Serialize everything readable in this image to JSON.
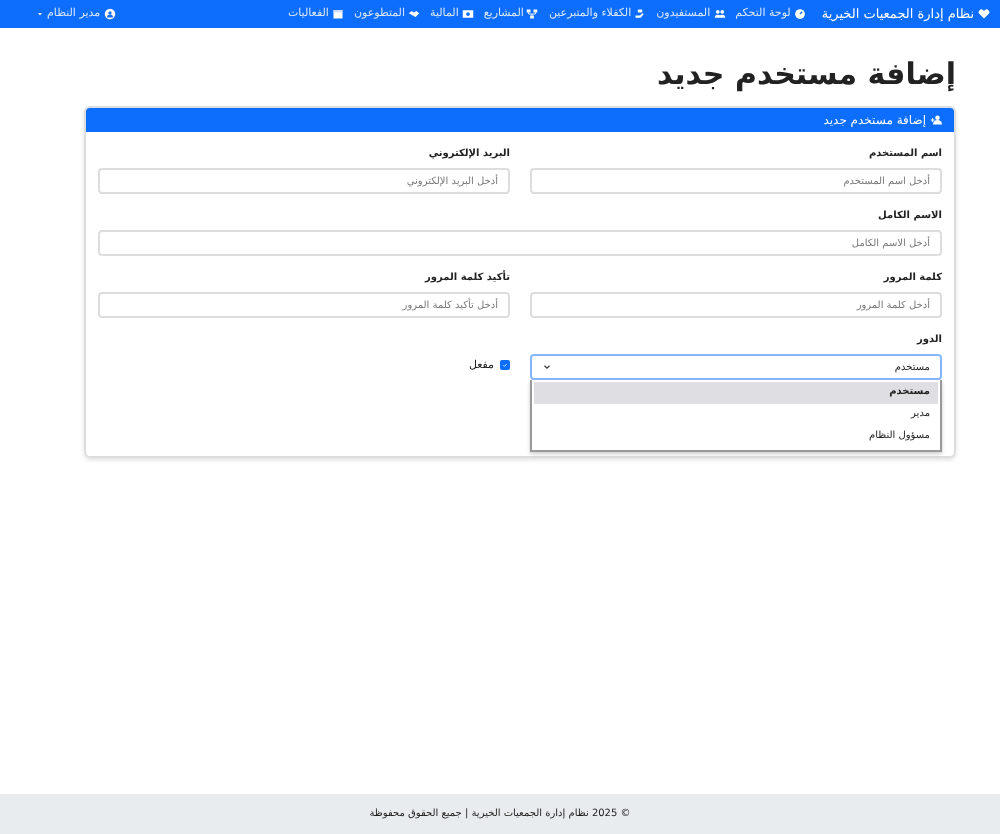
{
  "navbar": {
    "brand": "نظام إدارة الجمعيات الخيرية",
    "items": [
      {
        "label": "لوحة التحكم"
      },
      {
        "label": "المستفيدون"
      },
      {
        "label": "الكفلاء والمتبرعين"
      },
      {
        "label": "المشاريع"
      },
      {
        "label": "المالية"
      },
      {
        "label": "المتطوعون"
      },
      {
        "label": "الفعاليات"
      }
    ],
    "user_menu": "مدير النظام"
  },
  "page_title": "إضافة مستخدم جديد",
  "card": {
    "title": "إضافة مستخدم جديد",
    "fields": [
      {
        "label": "اسم المستخدم",
        "placeholder": "أدخل اسم المستخدم",
        "full_width": false
      },
      {
        "label": "البريد الإلكتروني",
        "placeholder": "أدخل البريد الإلكتروني",
        "full_width": false
      },
      {
        "label": "الاسم الكامل",
        "placeholder": "أدخل الاسم الكامل",
        "full_width": true
      },
      {
        "label": "كلمة المرور",
        "placeholder": "أدخل كلمة المرور",
        "full_width": false
      },
      {
        "label": "تأكيد كلمة المرور",
        "placeholder": "أدخل تأكيد كلمة المرور",
        "full_width": false
      }
    ],
    "role": {
      "label": "الدور",
      "value": "مستخدم",
      "expanded": true,
      "options": [
        {
          "label": "مستخدم",
          "selected": true
        },
        {
          "label": "مدير",
          "selected": false
        },
        {
          "label": "مسؤول النظام",
          "selected": false
        }
      ]
    },
    "active": {
      "label": "مفعل",
      "checked": true
    }
  },
  "footer": "© 2025 نظام إدارة الجمعيات الخيرية | جميع الحقوق محفوظة"
}
